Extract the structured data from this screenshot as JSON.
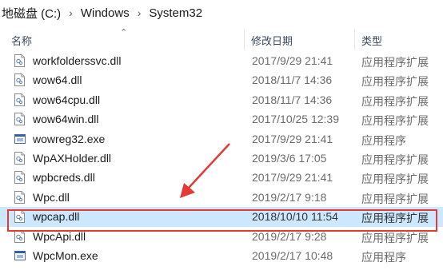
{
  "breadcrumb": [
    "地磁盘 (C:)",
    "Windows",
    "System32"
  ],
  "breadcrumb_sep": "›",
  "columns": {
    "name": "名称",
    "date": "修改日期",
    "type": "类型"
  },
  "sort_indicator": "⌃",
  "files": [
    {
      "name": "workfolderssvc.dll",
      "date": "2017/9/29 21:41",
      "type": "应用程序扩展",
      "icon": "dll-file-icon"
    },
    {
      "name": "wow64.dll",
      "date": "2018/11/7 14:36",
      "type": "应用程序扩展",
      "icon": "dll-file-icon"
    },
    {
      "name": "wow64cpu.dll",
      "date": "2018/11/7 14:36",
      "type": "应用程序扩展",
      "icon": "dll-file-icon"
    },
    {
      "name": "wow64win.dll",
      "date": "2017/10/25 12:39",
      "type": "应用程序扩展",
      "icon": "dll-file-icon"
    },
    {
      "name": "wowreg32.exe",
      "date": "2017/9/29 21:41",
      "type": "应用程序",
      "icon": "exe-file-icon"
    },
    {
      "name": "WpAXHolder.dll",
      "date": "2019/3/6 17:05",
      "type": "应用程序扩展",
      "icon": "dll-file-icon"
    },
    {
      "name": "wpbcreds.dll",
      "date": "2017/9/29 21:41",
      "type": "应用程序扩展",
      "icon": "dll-file-icon"
    },
    {
      "name": "Wpc.dll",
      "date": "2019/2/17 9:18",
      "type": "应用程序扩展",
      "icon": "dll-file-icon"
    },
    {
      "name": "wpcap.dll",
      "date": "2018/10/10 11:54",
      "type": "应用程序扩展",
      "icon": "dll-file-icon",
      "selected": true
    },
    {
      "name": "WpcApi.dll",
      "date": "2019/2/17 9:28",
      "type": "应用程序扩展",
      "icon": "dll-file-icon"
    },
    {
      "name": "WpcMon.exe",
      "date": "2019/2/17 10:48",
      "type": "应用程序",
      "icon": "exe-file-icon"
    }
  ],
  "colors": {
    "selection": "#cce8ff",
    "annotation": "#e53935"
  }
}
